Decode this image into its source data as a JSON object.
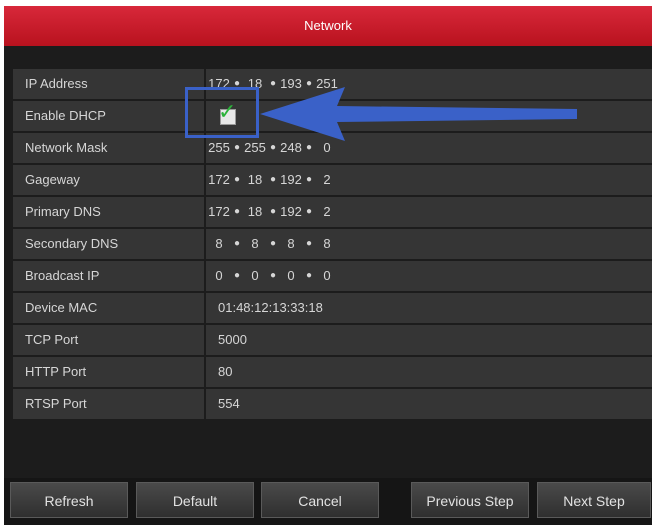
{
  "window": {
    "title": "Network"
  },
  "fields": [
    {
      "label": "IP Address",
      "type": "ip",
      "octets": [
        "172",
        "18",
        "193",
        "251"
      ]
    },
    {
      "label": "Enable DHCP",
      "type": "checkbox",
      "checked": true
    },
    {
      "label": "Network Mask",
      "type": "ip",
      "octets": [
        "255",
        "255",
        "248",
        "0"
      ]
    },
    {
      "label": "Gageway",
      "type": "ip",
      "octets": [
        "172",
        "18",
        "192",
        "2"
      ]
    },
    {
      "label": "Primary DNS",
      "type": "ip",
      "octets": [
        "172",
        "18",
        "192",
        "2"
      ]
    },
    {
      "label": "Secondary DNS",
      "type": "ip",
      "octets": [
        "8",
        "8",
        "8",
        "8"
      ]
    },
    {
      "label": "Broadcast IP",
      "type": "ip",
      "octets": [
        "0",
        "0",
        "0",
        "0"
      ]
    },
    {
      "label": "Device MAC",
      "type": "text",
      "value": "01:48:12:13:33:18"
    },
    {
      "label": "TCP Port",
      "type": "text",
      "value": "5000"
    },
    {
      "label": "HTTP Port",
      "type": "text",
      "value": "80"
    },
    {
      "label": "RTSP Port",
      "type": "text",
      "value": "554"
    }
  ],
  "buttons": {
    "refresh": "Refresh",
    "default": "Default",
    "cancel": "Cancel",
    "previous": "Previous Step",
    "next": "Next Step"
  },
  "icons": {
    "checkmark": "check-icon",
    "annotation_arrow": "arrow-left-icon"
  },
  "colors": {
    "titlebar": "#c81d2b",
    "annotation": "#3a61c8",
    "checkmark": "#2bb33a"
  }
}
